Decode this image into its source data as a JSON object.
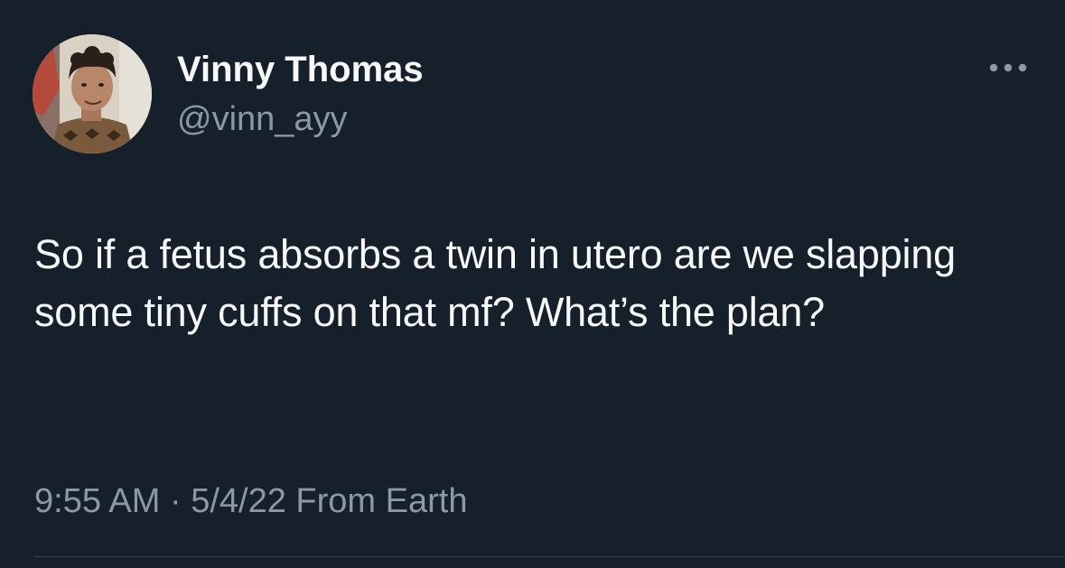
{
  "author": {
    "display_name": "Vinny Thomas",
    "handle": "@vinn_ayy",
    "avatar_icon": "profile-photo"
  },
  "tweet": {
    "text": "So if a fetus absorbs a twin in utero are we slapping some tiny cuffs on that mf? What’s the plan?",
    "time": "9:55 AM",
    "separator": "·",
    "date": "5/4/22",
    "source": "From Earth"
  },
  "actions": {
    "more_icon": "more-horizontal-icon"
  },
  "colors": {
    "background": "#15202b",
    "primary_text": "#f7f9f9",
    "secondary_text": "#8b98a5",
    "divider": "#38444d"
  }
}
